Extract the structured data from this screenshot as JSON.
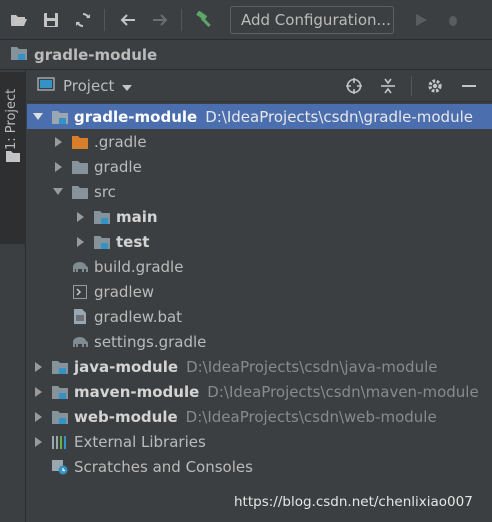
{
  "toolbar": {
    "buttons": [
      "open-icon",
      "save-icon",
      "sync-icon",
      "back-icon",
      "forward-icon",
      "build-icon"
    ],
    "run_config_label": "Add Configuration...",
    "run_icon": "run-icon"
  },
  "breadcrumb": {
    "label": "gradle-module"
  },
  "left_stripe": {
    "tab_label": "1: Project"
  },
  "panel": {
    "view_label": "Project",
    "actions": [
      "locate-icon",
      "collapse-icon",
      "settings-icon"
    ]
  },
  "tree": {
    "rows": [
      {
        "name": "gradle-module",
        "path": "D:\\IdeaProjects\\csdn\\gradle-module"
      },
      {
        "name": ".gradle"
      },
      {
        "name": "gradle"
      },
      {
        "name": "src"
      },
      {
        "name": "main"
      },
      {
        "name": "test"
      },
      {
        "name": "build.gradle"
      },
      {
        "name": "gradlew"
      },
      {
        "name": "gradlew.bat"
      },
      {
        "name": "settings.gradle"
      },
      {
        "name": "java-module",
        "path": "D:\\IdeaProjects\\csdn\\java-module"
      },
      {
        "name": "maven-module",
        "path": "D:\\IdeaProjects\\csdn\\maven-module"
      },
      {
        "name": "web-module",
        "path": "D:\\IdeaProjects\\csdn\\web-module"
      },
      {
        "name": "External Libraries"
      },
      {
        "name": "Scratches and Consoles"
      }
    ]
  },
  "colors": {
    "background": "#3c3f41",
    "selection": "#4b6eaf",
    "folder": "#87939a",
    "module_badge": "#3592c4",
    "excluded_folder": "#d97e2b"
  },
  "watermark": "https://blog.csdn.net/chenlixiao007"
}
